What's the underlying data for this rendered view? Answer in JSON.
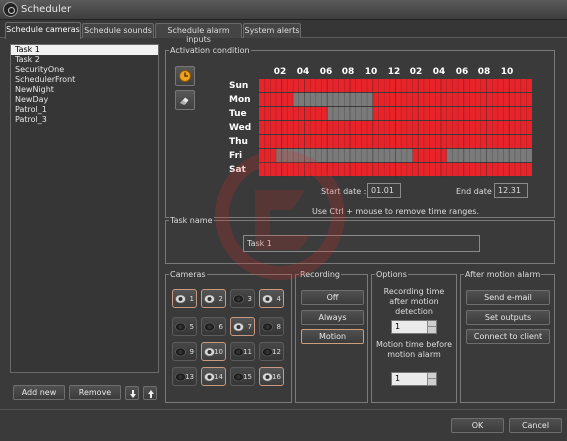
{
  "window": {
    "title": "Scheduler"
  },
  "tabs": [
    "Schedule cameras",
    "Schedule sounds",
    "Schedule alarm inputs",
    "System alerts"
  ],
  "tasks": {
    "items": [
      "Task 1",
      "Task 2",
      "SecurityOne",
      "SchedulerFront",
      "NewNight",
      "NewDay",
      "Patrol_1",
      "Patrol_3"
    ],
    "selected_index": 0,
    "add_label": "Add new",
    "remove_label": "Remove"
  },
  "activation": {
    "label": "Activation condition",
    "hour_labels": [
      "02",
      "04",
      "06",
      "08",
      "10",
      "12",
      "02",
      "04",
      "06",
      "08",
      "10"
    ],
    "days": [
      "Sun",
      "Mon",
      "Tue",
      "Wed",
      "Thu",
      "Fri",
      "Sat"
    ],
    "active_color": "#e8242a",
    "inactive_color": "#7a7a7a",
    "schedule_half_hours": [
      [
        [
          0,
          48
        ]
      ],
      [
        [
          0,
          6
        ],
        [
          20,
          48
        ]
      ],
      [
        [
          0,
          12
        ],
        [
          20,
          48
        ]
      ],
      [
        [
          0,
          48
        ]
      ],
      [
        [
          0,
          48
        ]
      ],
      [
        [
          0,
          3
        ],
        [
          27,
          33
        ]
      ],
      [
        [
          0,
          48
        ]
      ]
    ],
    "start_date_label": "Start date :",
    "start_date": "01.01",
    "end_date_label": "End date :",
    "end_date": "12.31",
    "hint": "Use Ctrl + mouse to remove time ranges."
  },
  "task_name": {
    "label": "Task name",
    "value": "Task 1"
  },
  "cameras": {
    "label": "Cameras",
    "items": [
      {
        "num": "1",
        "enabled": true
      },
      {
        "num": "2",
        "enabled": true
      },
      {
        "num": "3",
        "enabled": false
      },
      {
        "num": "4",
        "enabled": true
      },
      {
        "num": "5",
        "enabled": false
      },
      {
        "num": "6",
        "enabled": false
      },
      {
        "num": "7",
        "enabled": true
      },
      {
        "num": "8",
        "enabled": false
      },
      {
        "num": "9",
        "enabled": false
      },
      {
        "num": "10",
        "enabled": true
      },
      {
        "num": "11",
        "enabled": false
      },
      {
        "num": "12",
        "enabled": false
      },
      {
        "num": "13",
        "enabled": false
      },
      {
        "num": "14",
        "enabled": true
      },
      {
        "num": "15",
        "enabled": false
      },
      {
        "num": "16",
        "enabled": true
      }
    ]
  },
  "recording": {
    "label": "Recording",
    "off": "Off",
    "always": "Always",
    "motion": "Motion",
    "selected": "Motion"
  },
  "options": {
    "label": "Options",
    "rec_time_label": "Recording time after motion detection",
    "rec_time_value": "1",
    "motion_time_label": "Motion time before motion alarm",
    "motion_time_value": "1"
  },
  "after_alarm": {
    "label": "After motion alarm",
    "email": "Send e-mail",
    "outputs": "Set outputs",
    "connect": "Connect to client"
  },
  "footer": {
    "ok": "OK",
    "cancel": "Cancel"
  }
}
